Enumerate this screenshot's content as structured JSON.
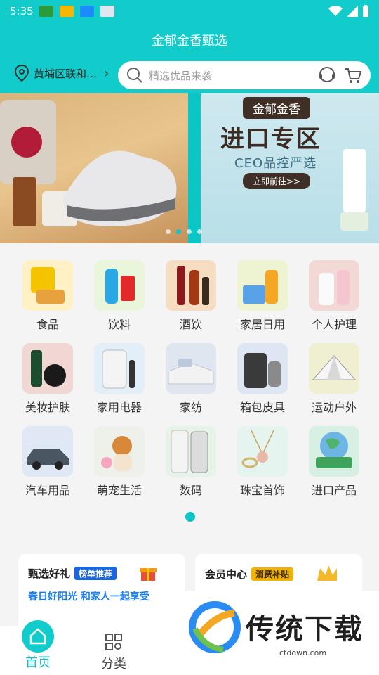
{
  "status_bar": {
    "time": "5:35",
    "app_icon_colors": [
      "#2c9b3a",
      "#f7b500",
      "#1a8cff",
      "#e0e6f0"
    ],
    "icons": [
      "wifi-icon",
      "signal-icon",
      "battery-icon"
    ]
  },
  "header": {
    "title": "金郁金香甄选",
    "location": "黄埔区联和…",
    "search_placeholder": "精选优品来袭",
    "accent": "#12cccb"
  },
  "banner": {
    "tag": "金郁金香",
    "headline": "进口专区",
    "subline": "CEO品控严选",
    "cta": "立即前往>>"
  },
  "categories": [
    {
      "label": "食品"
    },
    {
      "label": "饮料"
    },
    {
      "label": "酒饮"
    },
    {
      "label": "家居日用"
    },
    {
      "label": "个人护理"
    },
    {
      "label": "美妆护肤"
    },
    {
      "label": "家用电器"
    },
    {
      "label": "家纺"
    },
    {
      "label": "箱包皮具"
    },
    {
      "label": "运动户外"
    },
    {
      "label": "汽车用品"
    },
    {
      "label": "萌宠生活"
    },
    {
      "label": "数码"
    },
    {
      "label": "珠宝首饰"
    },
    {
      "label": "进口产品"
    }
  ],
  "promos": [
    {
      "title": "甄选好礼",
      "badge": "榜单推荐",
      "badge_color": "#1a66e0",
      "subtitle": "春日好阳光 和家人一起享受"
    },
    {
      "title": "会员中心",
      "badge": "消费补贴",
      "badge_color": "#f2b300",
      "subtitle": ""
    }
  ],
  "tabbar": {
    "tabs": [
      {
        "label": "首页",
        "active": true
      },
      {
        "label": "分类",
        "active": false
      }
    ]
  },
  "watermark": {
    "text": "传统下载",
    "url": "ctdown.com"
  }
}
